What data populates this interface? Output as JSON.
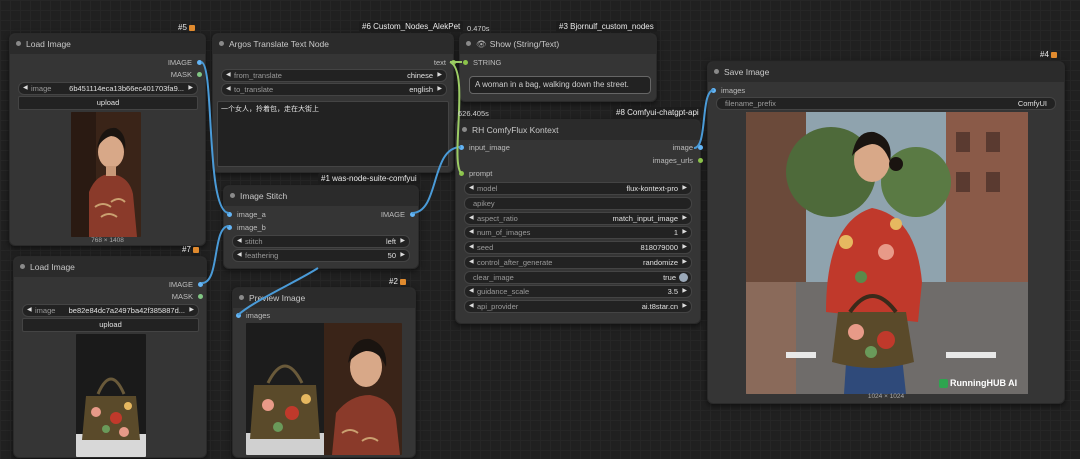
{
  "nodes": {
    "load_image_1": {
      "badge": "#5",
      "title": "Load Image",
      "outputs": [
        "IMAGE",
        "MASK"
      ],
      "image_label": "image",
      "image_value": "6b451114eca13b66ec401703fa9...",
      "upload_label": "upload",
      "dims": "768 × 1408"
    },
    "argos": {
      "pack": "#6 Custom_Nodes_AlekPet",
      "title": "Argos Translate Text Node",
      "output": "text",
      "from_label": "from_translate",
      "from_value": "chinese",
      "to_label": "to_translate",
      "to_value": "english",
      "text": "一个女人，拎着包，走在大街上"
    },
    "show": {
      "pack": "#3 Bjornulf_custom_nodes",
      "timing": "0.470s",
      "title": "Show (String/Text)",
      "input": "STRING",
      "value": "A woman in a bag, walking down the street."
    },
    "save": {
      "badge": "#4",
      "title": "Save Image",
      "input": "images",
      "prefix_label": "filename_prefix",
      "prefix_value": "ComfyUI",
      "dims": "1024 × 1024",
      "watermark": "RunningHUB AI"
    },
    "kontext": {
      "pack": "#8 Comfyui-chatgpt-api",
      "timing": "626.405s",
      "title": "RH ComfyFlux Kontext",
      "inputs": [
        "input_image",
        "prompt"
      ],
      "outputs": [
        "image",
        "images_urls"
      ],
      "widgets": [
        {
          "label": "model",
          "value": "flux-kontext-pro",
          "kind": "combo"
        },
        {
          "label": "apikey",
          "value": "",
          "kind": "text"
        },
        {
          "label": "aspect_ratio",
          "value": "match_input_image",
          "kind": "combo"
        },
        {
          "label": "num_of_images",
          "value": "1",
          "kind": "combo"
        },
        {
          "label": "seed",
          "value": "818079000",
          "kind": "combo"
        },
        {
          "label": "control_after_generate",
          "value": "randomize",
          "kind": "combo"
        },
        {
          "label": "clear_image",
          "value": "true",
          "kind": "toggle"
        },
        {
          "label": "guidance_scale",
          "value": "3.5",
          "kind": "combo"
        },
        {
          "label": "api_provider",
          "value": "ai.t8star.cn",
          "kind": "combo"
        }
      ]
    },
    "stitch": {
      "pack": "#1 was-node-suite-comfyui",
      "title": "Image Stitch",
      "inputs": [
        "image_a",
        "image_b"
      ],
      "output": "IMAGE",
      "stitch_label": "stitch",
      "stitch_value": "left",
      "feather_label": "feathering",
      "feather_value": "50"
    },
    "load_image_2": {
      "badge": "#7",
      "title": "Load Image",
      "outputs": [
        "IMAGE",
        "MASK"
      ],
      "image_label": "image",
      "image_value": "be82e84dc7a2497ba42f385887d...",
      "upload_label": "upload"
    },
    "preview": {
      "badge": "#2",
      "title": "Preview Image",
      "input": "images"
    }
  },
  "colors": {
    "image_port": "#64b5f6",
    "mask_port": "#81c784",
    "string_port": "#8bc34a",
    "wire_image": "#4a9bd8",
    "wire_string": "#9ccc65"
  }
}
